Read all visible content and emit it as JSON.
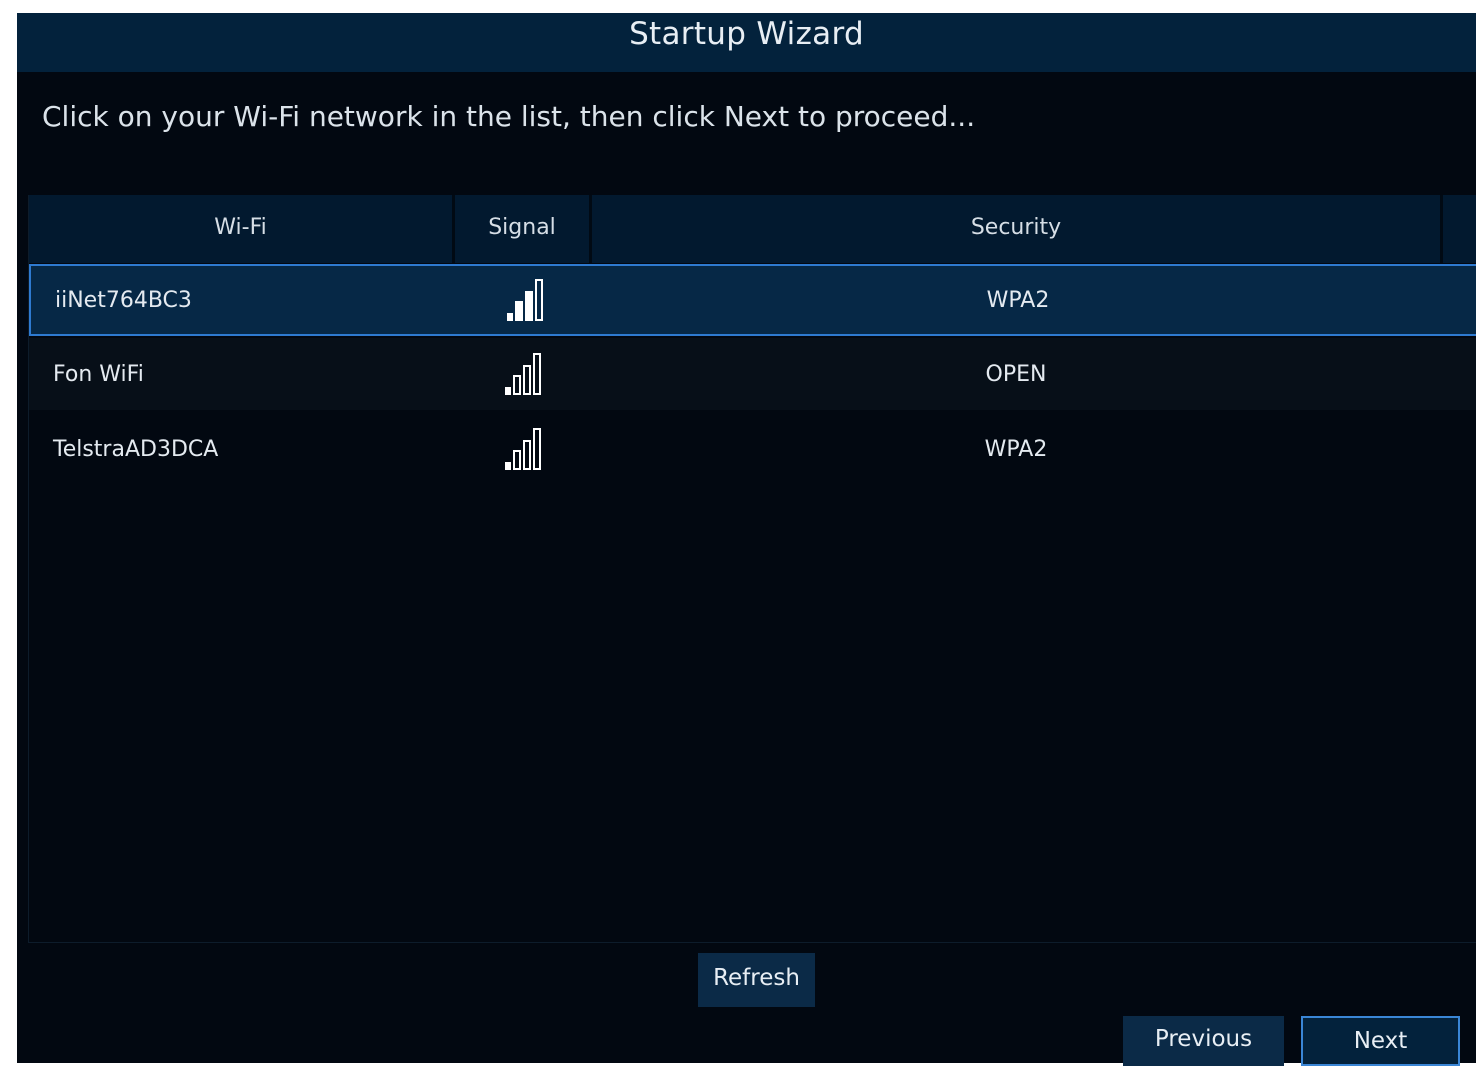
{
  "window": {
    "title": "Startup Wizard"
  },
  "instruction": "Click on your Wi-Fi network in the list, then click Next to proceed...",
  "table": {
    "columns": [
      "Wi-Fi",
      "Signal",
      "Security"
    ],
    "rows": [
      {
        "wifi": "iiNet764BC3",
        "signal_bars": 3,
        "signal_max": 4,
        "security": "WPA2",
        "selected": true
      },
      {
        "wifi": "Fon WiFi",
        "signal_bars": 1,
        "signal_max": 4,
        "security": "OPEN",
        "selected": false
      },
      {
        "wifi": "TelstraAD3DCA",
        "signal_bars": 1,
        "signal_max": 4,
        "security": "WPA2",
        "selected": false
      }
    ]
  },
  "buttons": {
    "refresh": "Refresh",
    "previous": "Previous",
    "next": "Next"
  },
  "colors": {
    "title_bar": "#03223c",
    "background": "#020811",
    "selected_border": "#2e7ad0",
    "button": "#0b2a47"
  },
  "icons": {
    "signal": "signal-strength-icon"
  }
}
